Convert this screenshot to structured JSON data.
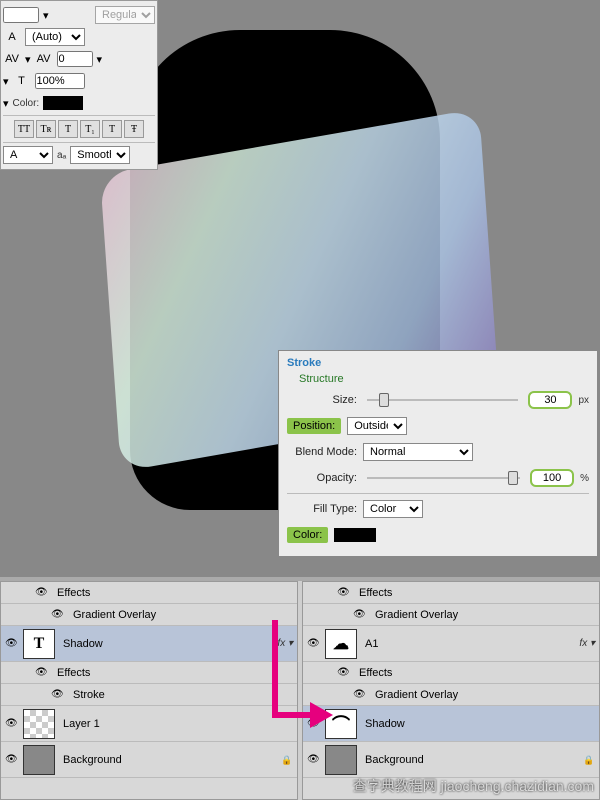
{
  "charPanel": {
    "fontSize": "",
    "fontStyle": "Regular",
    "leading": "(Auto)",
    "tracking": "0",
    "scale": "100%",
    "colorLabel": "Color:",
    "ttButtons": [
      "TT",
      "Tr",
      "T",
      "T₁",
      "T¹",
      "T",
      "Ŧ"
    ],
    "aaLabel": "aₐ",
    "aaValue": "Smooth"
  },
  "strokePanel": {
    "title": "Stroke",
    "structureLabel": "Structure",
    "sizeLabel": "Size:",
    "sizeValue": "30",
    "sizePx": "px",
    "positionLabel": "Position:",
    "positionValue": "Outside",
    "blendModeLabel": "Blend Mode:",
    "blendModeValue": "Normal",
    "opacityLabel": "Opacity:",
    "opacityValue": "100",
    "opacityPct": "%",
    "fillTypeLabel": "Fill Type:",
    "fillTypeValue": "Color",
    "colorLabel": "Color:"
  },
  "layersLeft": {
    "rows": [
      {
        "type": "sub",
        "label": "Effects",
        "icon": "eye"
      },
      {
        "type": "sub2",
        "label": "Gradient Overlay",
        "icon": "eye"
      },
      {
        "type": "layer",
        "name": "Shadow",
        "thumb": "T",
        "fx": "fx",
        "selected": true
      },
      {
        "type": "sub",
        "label": "Effects",
        "icon": "eye"
      },
      {
        "type": "sub2",
        "label": "Stroke",
        "icon": "eye"
      },
      {
        "type": "layer",
        "name": "Layer 1",
        "thumb": "check"
      },
      {
        "type": "layer",
        "name": "Background",
        "thumb": "bg",
        "locked": true
      }
    ]
  },
  "layersRight": {
    "rows": [
      {
        "type": "sub",
        "label": "Effects",
        "icon": "eye"
      },
      {
        "type": "sub2",
        "label": "Gradient Overlay",
        "icon": "eye"
      },
      {
        "type": "layer",
        "name": "A1",
        "thumb": "cloud",
        "fx": "fx"
      },
      {
        "type": "sub",
        "label": "Effects",
        "icon": "eye"
      },
      {
        "type": "sub2",
        "label": "Gradient Overlay",
        "icon": "eye"
      },
      {
        "type": "layer",
        "name": "Shadow",
        "thumb": "arch",
        "selected": true
      },
      {
        "type": "layer",
        "name": "Background",
        "thumb": "bg",
        "locked": true
      }
    ]
  },
  "watermark": "查字典教程网 jiaocheng.chazidian.com"
}
